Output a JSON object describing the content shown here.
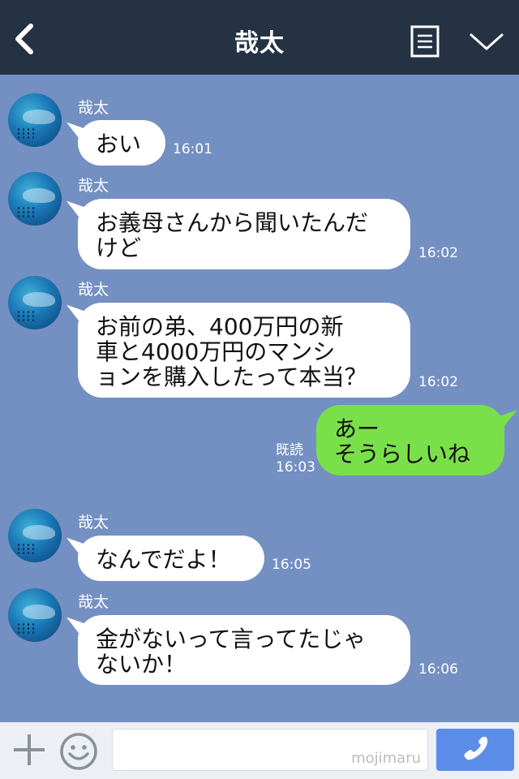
{
  "header": {
    "title": "哉太",
    "back_icon": "back-chevron-icon",
    "menu_icon": "menu-list-icon",
    "expand_icon": "chevron-down-icon",
    "background": "#253244"
  },
  "chat": {
    "background": "#7490c2",
    "messages": [
      {
        "sender": "哉太",
        "side": "left",
        "lines": [
          "おい"
        ],
        "time": "16:01"
      },
      {
        "sender": "哉太",
        "side": "left",
        "lines": [
          "お義母さんから聞いたんだ",
          "けど"
        ],
        "time": "16:02"
      },
      {
        "sender": "哉太",
        "side": "left",
        "lines": [
          "お前の弟、400万円の新",
          "車と4000万円のマンシ",
          "ョンを購入したって本当？"
        ],
        "time": "16:02"
      },
      {
        "sender": "me",
        "side": "right",
        "lines": [
          "あー",
          "そうらしいね"
        ],
        "read": "既読",
        "time": "16:03"
      },
      {
        "sender": "哉太",
        "side": "left",
        "lines": [
          "なんでだよ！"
        ],
        "time": "16:05"
      },
      {
        "sender": "哉太",
        "side": "left",
        "lines": [
          "金がないって言ってたじゃ",
          "ないか！"
        ],
        "time": "16:06"
      }
    ]
  },
  "footer": {
    "plus_icon": "plus-icon",
    "sticker_icon": "smiley-icon",
    "input_value": "",
    "watermark": "mojimaru",
    "call_icon": "phone-icon",
    "call_color": "#5b8de8"
  },
  "colors": {
    "incoming_bubble": "#ffffff",
    "outgoing_bubble": "#79e04a"
  }
}
